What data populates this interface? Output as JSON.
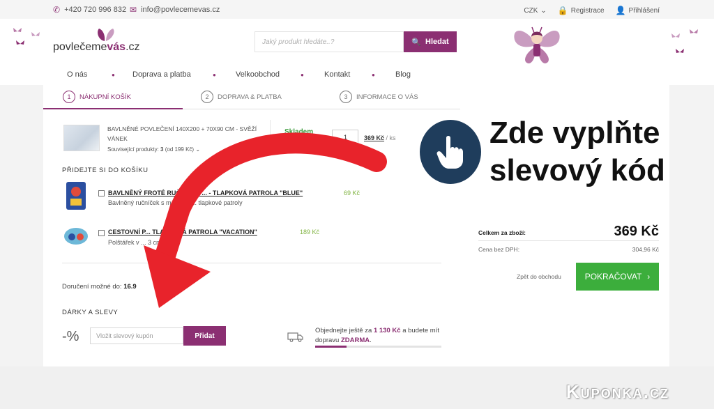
{
  "topbar": {
    "phone": "+420 720 996 832",
    "email": "info@povlecemevas.cz",
    "currency": "CZK",
    "register": "Registrace",
    "login": "Přihlášení"
  },
  "header": {
    "logo_prefix": "povlečeme",
    "logo_brand": "vás",
    "logo_suffix": ".cz",
    "search_placeholder": "Jaký produkt hledáte..?",
    "search_button": "Hledat",
    "nav": [
      "O nás",
      "Doprava a platba",
      "Velkoobchod",
      "Kontakt",
      "Blog"
    ]
  },
  "steps": [
    {
      "num": "1",
      "label": "NÁKUPNÍ KOŠÍK"
    },
    {
      "num": "2",
      "label": "DOPRAVA & PLATBA"
    },
    {
      "num": "3",
      "label": "INFORMACE O VÁS"
    }
  ],
  "cart_item": {
    "name": "BAVLNĚNÉ POVLEČENÍ 140X200 + 70X90 CM - SVĚŽÍ VÁNEK",
    "related_label": "Související produkty:",
    "related_count": "3",
    "related_from": "(od 199 Kč)",
    "stock": "Skladem",
    "qty": "1",
    "price": "369 Kč",
    "unit": "/ ks"
  },
  "upsell": {
    "title": "PŘIDEJTE SI DO KOŠÍKU",
    "items": [
      {
        "name": "BAVLNĚNÝ FROTÉ RUČNÍČEK ... - TLAPKOVÁ PATROLA \"BLUE\"",
        "price": "69 Kč",
        "desc": "Bavlněný ručníček s motivem ... tlapkové patroly"
      },
      {
        "name": "CESTOVNÍ P... TLAPKOVÁ PATROLA \"VACATION\"",
        "price": "189 Kč",
        "desc": "Polštářek v ... 3 cm."
      }
    ]
  },
  "delivery": {
    "label": "Doručení možné do:",
    "date": "16.9"
  },
  "discount": {
    "title": "DÁRKY A SLEVY",
    "symbol": "-%",
    "coupon_placeholder": "Vložit slevový kupón",
    "coupon_button": "Přidat"
  },
  "free_shipping": {
    "pre": "Objednejte ještě za",
    "amount": "1 130 Kč",
    "mid": "a budete mít dopravu",
    "free": "ZDARMA",
    "period": ".",
    "progress": 0.25
  },
  "summary": {
    "total_label": "Celkem za zboží:",
    "total_value": "369 Kč",
    "net_label": "Cena bez DPH:",
    "net_value": "304,96 Kč",
    "back_link": "Zpět do obchodu",
    "continue": "POKRAČOVAT"
  },
  "promo": {
    "line1": "Zde vyplňte",
    "line2": "slevový kód"
  },
  "watermark": "Kuponka.cz",
  "colors": {
    "brand": "#8b2f72",
    "green": "#3cae3c",
    "arrow": "#e8232b",
    "hand_bg": "#1f3d5c"
  }
}
